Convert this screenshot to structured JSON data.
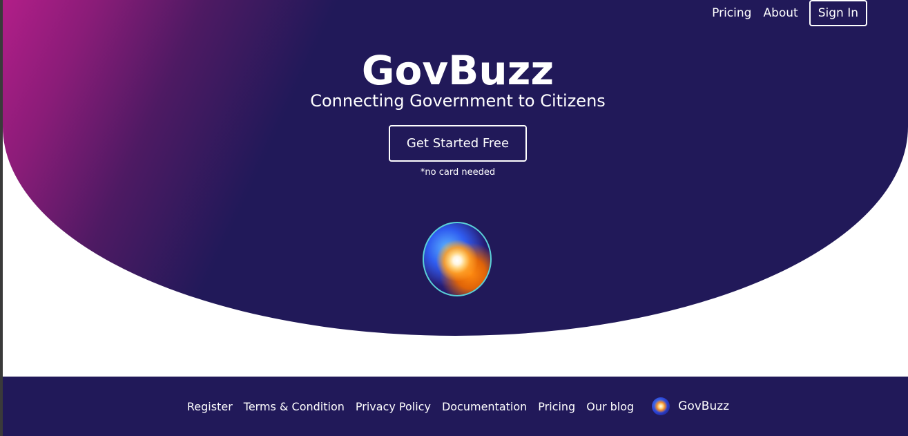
{
  "nav": {
    "pricing": "Pricing",
    "about": "About",
    "signin": "Sign In"
  },
  "hero": {
    "title": "GovBuzz",
    "subtitle": "Connecting Government to Citizens",
    "cta": "Get Started Free",
    "note": "*no card needed"
  },
  "footer": {
    "links": [
      "Register",
      "Terms & Condition",
      "Privacy Policy",
      "Documentation",
      "Pricing",
      "Our blog"
    ],
    "brand": "GovBuzz"
  },
  "colors": {
    "navy": "#211959",
    "magenta": "#c21f8f",
    "white": "#ffffff"
  }
}
